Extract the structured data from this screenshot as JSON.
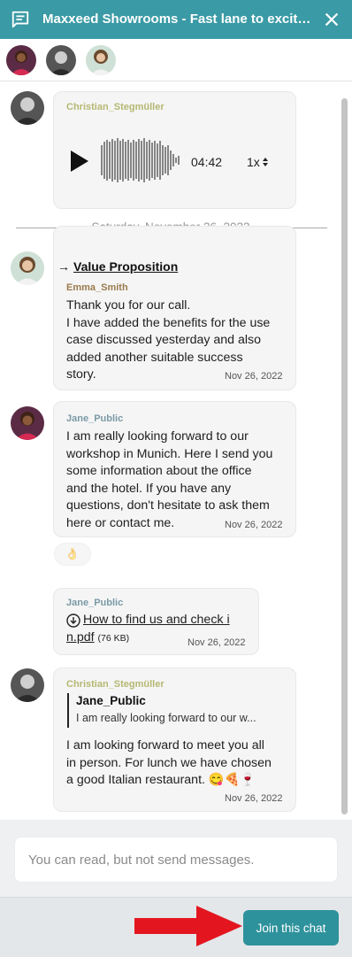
{
  "header": {
    "title": "Maxxeed Showrooms - Fast lane to excite y...",
    "bg_color": "#3a9aa5"
  },
  "messages": {
    "audio": {
      "sender": "Christian_Stegmüller",
      "duration": "04:42",
      "speed": "1x"
    },
    "date_separator": "Saturday, November 26, 2022",
    "m1": {
      "link_title": "Value Proposition",
      "sender": "Emma_Smith",
      "lines": [
        "Thank you for our call.",
        "I have added the benefits for the use",
        "case discussed yesterday and also",
        "added another suitable success",
        "story."
      ],
      "time": "Nov 26, 2022"
    },
    "m2": {
      "sender": "Jane_Public",
      "lines": [
        "I am really looking forward to our",
        "workshop in Munich. Here I send you",
        "some information about the office",
        "and the hotel. If you have any",
        "questions, don't hesitate to ask them",
        "here or contact me."
      ],
      "time": "Nov 26, 2022",
      "reaction": "👌"
    },
    "m3": {
      "sender": "Jane_Public",
      "file_line1": "How to find us and check i",
      "file_line2": "n.pdf",
      "file_size": "(76 KB)",
      "time": "Nov 26, 2022"
    },
    "m4": {
      "sender": "Christian_Stegmüller",
      "quote_author": "Jane_Public",
      "quote_text": "I am really looking forward to our w...",
      "lines": [
        "I am looking forward to meet you all",
        "in person. For lunch we have chosen",
        "a good Italian restaurant. 😋🍕🍷"
      ],
      "time": "Nov 26, 2022"
    }
  },
  "footer": {
    "placeholder": "You can read, but not send messages.",
    "join_label": "Join this chat"
  }
}
